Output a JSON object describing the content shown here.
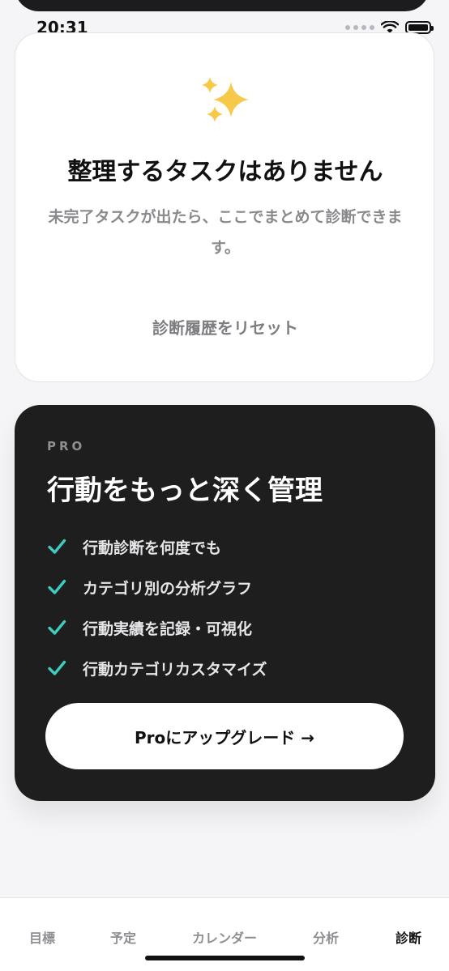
{
  "status_bar": {
    "time": "20:31"
  },
  "empty_state": {
    "icon": "sparkles-icon",
    "title": "整理するタスクはありません",
    "description": "未完了タスクが出たら、ここでまとめて診断できます。",
    "reset_label": "診断履歴をリセット"
  },
  "pro": {
    "tag": "PRO",
    "title": "行動をもっと深く管理",
    "features": [
      "行動診断を何度でも",
      "カテゴリ別の分析グラフ",
      "行動実績を記録・可視化",
      "行動カテゴリカスタマイズ"
    ],
    "upgrade_label": "Proにアップグレード →",
    "check_color": "#3ecbc0"
  },
  "tabs": [
    {
      "label": "目標",
      "active": false
    },
    {
      "label": "予定",
      "active": false
    },
    {
      "label": "カレンダー",
      "active": false
    },
    {
      "label": "分析",
      "active": false
    },
    {
      "label": "診断",
      "active": true
    }
  ]
}
